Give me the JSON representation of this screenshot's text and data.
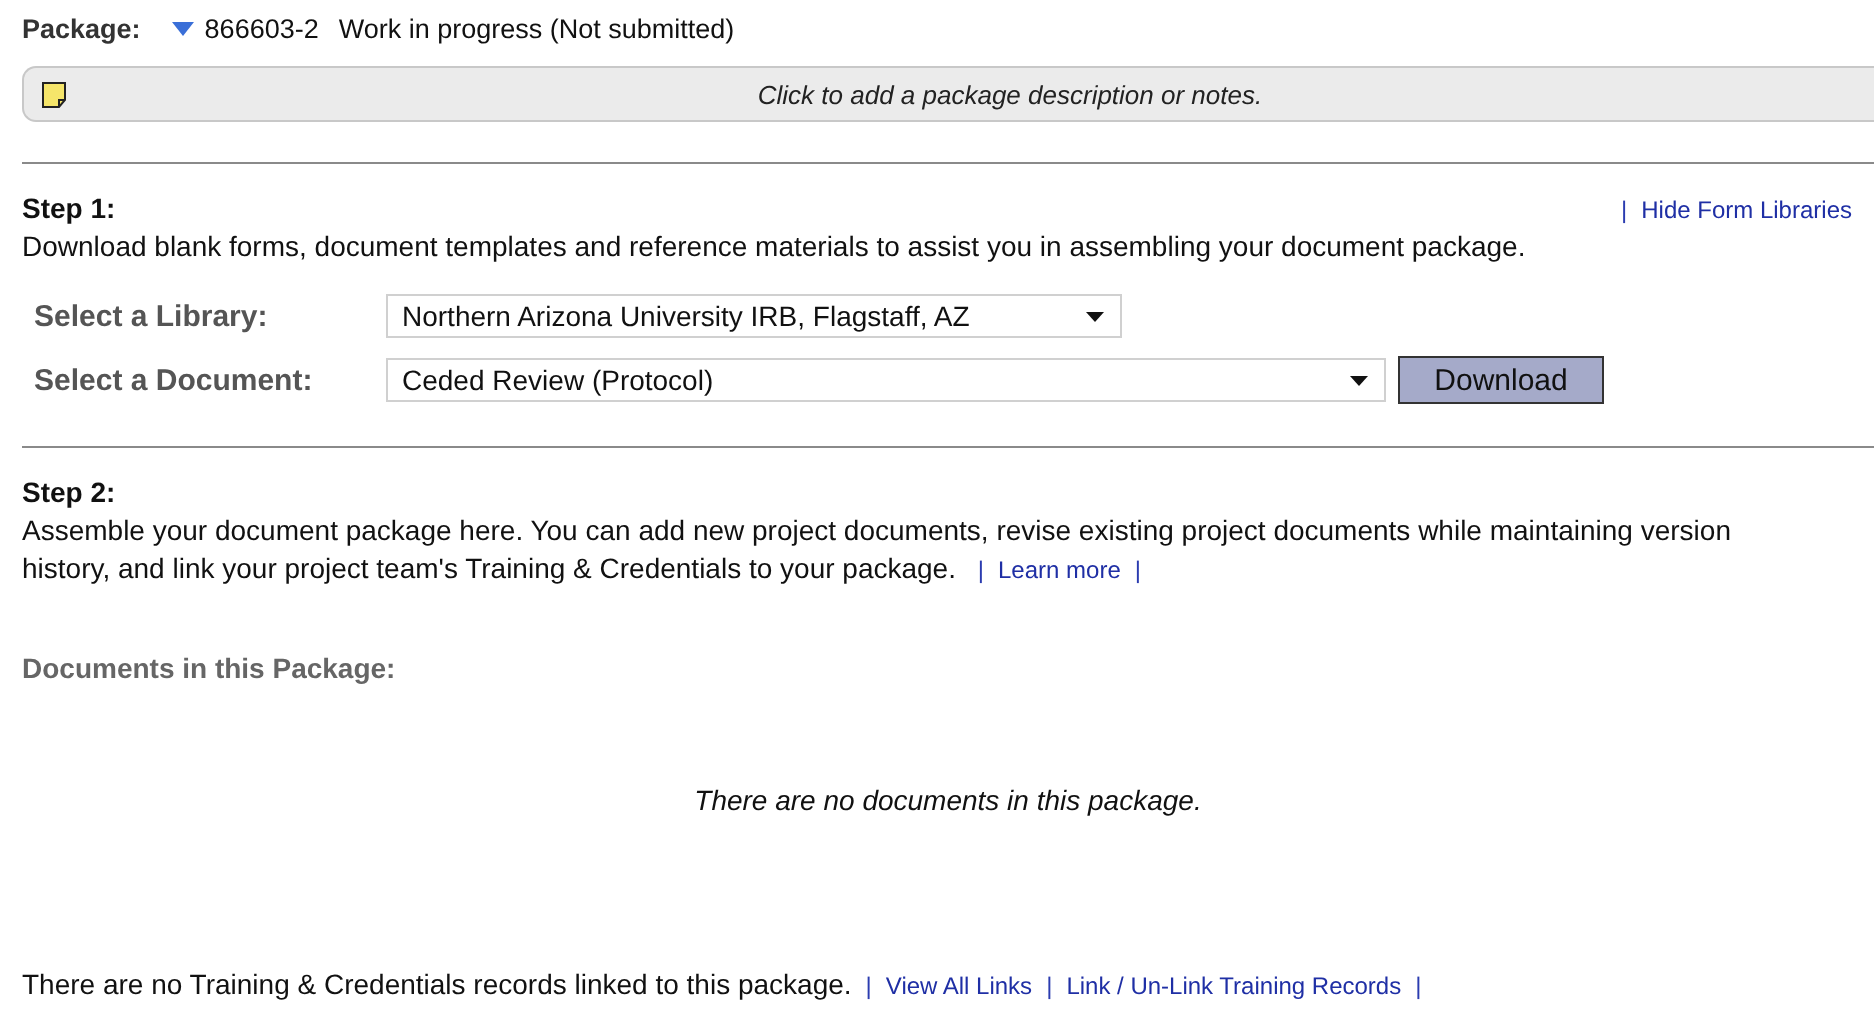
{
  "package": {
    "label": "Package:",
    "number": "866603-2",
    "status": "Work in progress (Not submitted)"
  },
  "notes": {
    "placeholder": "Click to add a package description or notes."
  },
  "step1": {
    "title": "Step 1:",
    "links": [
      {
        "kind": "separator",
        "text": "|"
      },
      {
        "kind": "link",
        "text": "Hide Form Libraries"
      }
    ],
    "description": "Download blank forms, document templates and reference materials to assist you in assembling your document package.",
    "fields": [
      {
        "label": "Select a Library:",
        "value": "Northern Arizona University IRB, Flagstaff, AZ"
      },
      {
        "label": "Select a Document:",
        "value": "Ceded Review (Protocol)",
        "button": "Download"
      }
    ]
  },
  "step2": {
    "title": "Step 2:",
    "description": "Assemble your document package here. You can add new project documents, revise existing project documents while maintaining version history, and link your project team's Training & Credentials to your package.",
    "links": [
      {
        "kind": "separator",
        "text": "|"
      },
      {
        "kind": "link",
        "text": "Learn more"
      },
      {
        "kind": "separator",
        "text": "|"
      }
    ],
    "documents_heading": "Documents in this Package:",
    "empty_message": "There are no documents in this package."
  },
  "footer": {
    "message": "There are no Training & Credentials records linked to this package.",
    "links": [
      {
        "kind": "separator",
        "text": "|"
      },
      {
        "kind": "link",
        "text": "View All Links"
      },
      {
        "kind": "separator",
        "text": "|"
      },
      {
        "kind": "link",
        "text": "Link / Un-Link Training Records"
      },
      {
        "kind": "separator",
        "text": "|"
      }
    ]
  }
}
